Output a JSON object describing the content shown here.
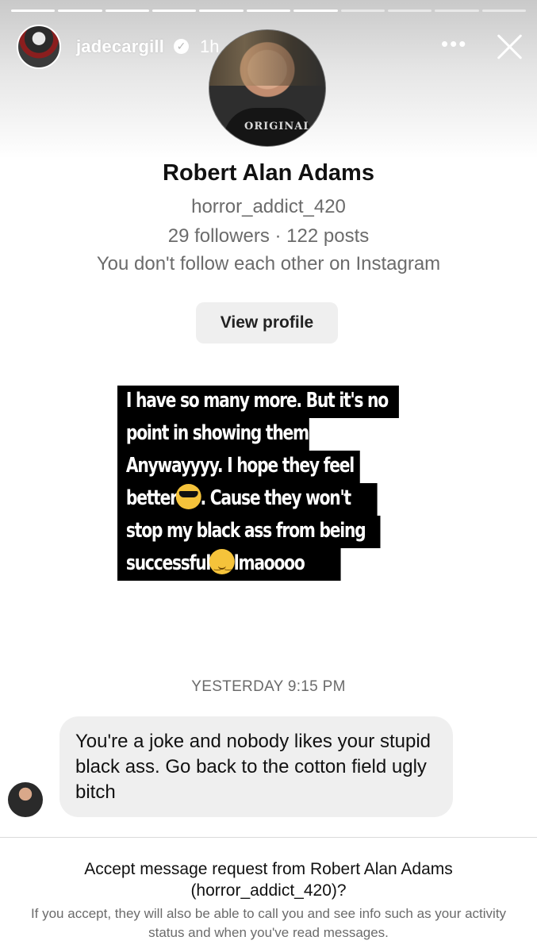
{
  "story": {
    "username": "jadecargill",
    "time_ago": "1h",
    "progress_segments_total": 11,
    "progress_segments_done": 7
  },
  "profile": {
    "name": "Robert Alan Adams",
    "handle": "horror_addict_420",
    "stats": "29 followers · 122 posts",
    "mutual_status": "You don't follow each other on Instagram",
    "view_button": "View profile",
    "photo_shirt_text": "ORIGINAL"
  },
  "caption": {
    "lines": [
      "I have so many more. But it's no",
      "point in showing them.",
      "Anywayyyy. I hope they feel",
      "better",
      ". Cause they won't",
      "stop my black ass from being",
      "successful",
      "lmaoooo"
    ],
    "emoji_1": "smiling-face-with-sunglasses",
    "emoji_2": "relieved-face"
  },
  "conversation": {
    "timestamp": "YESTERDAY 9:15 PM",
    "message": "You're a joke and nobody likes your stupid black ass. Go back to the cotton field ugly bitch"
  },
  "request": {
    "title": "Accept message request from Robert Alan Adams (horror_addict_420)?",
    "info": "If you accept, they will also be able to call you and see info such as your activity status and when you've read messages."
  },
  "icons": {
    "verified": "verified-badge-icon",
    "more": "more-options-icon",
    "close": "close-icon"
  }
}
